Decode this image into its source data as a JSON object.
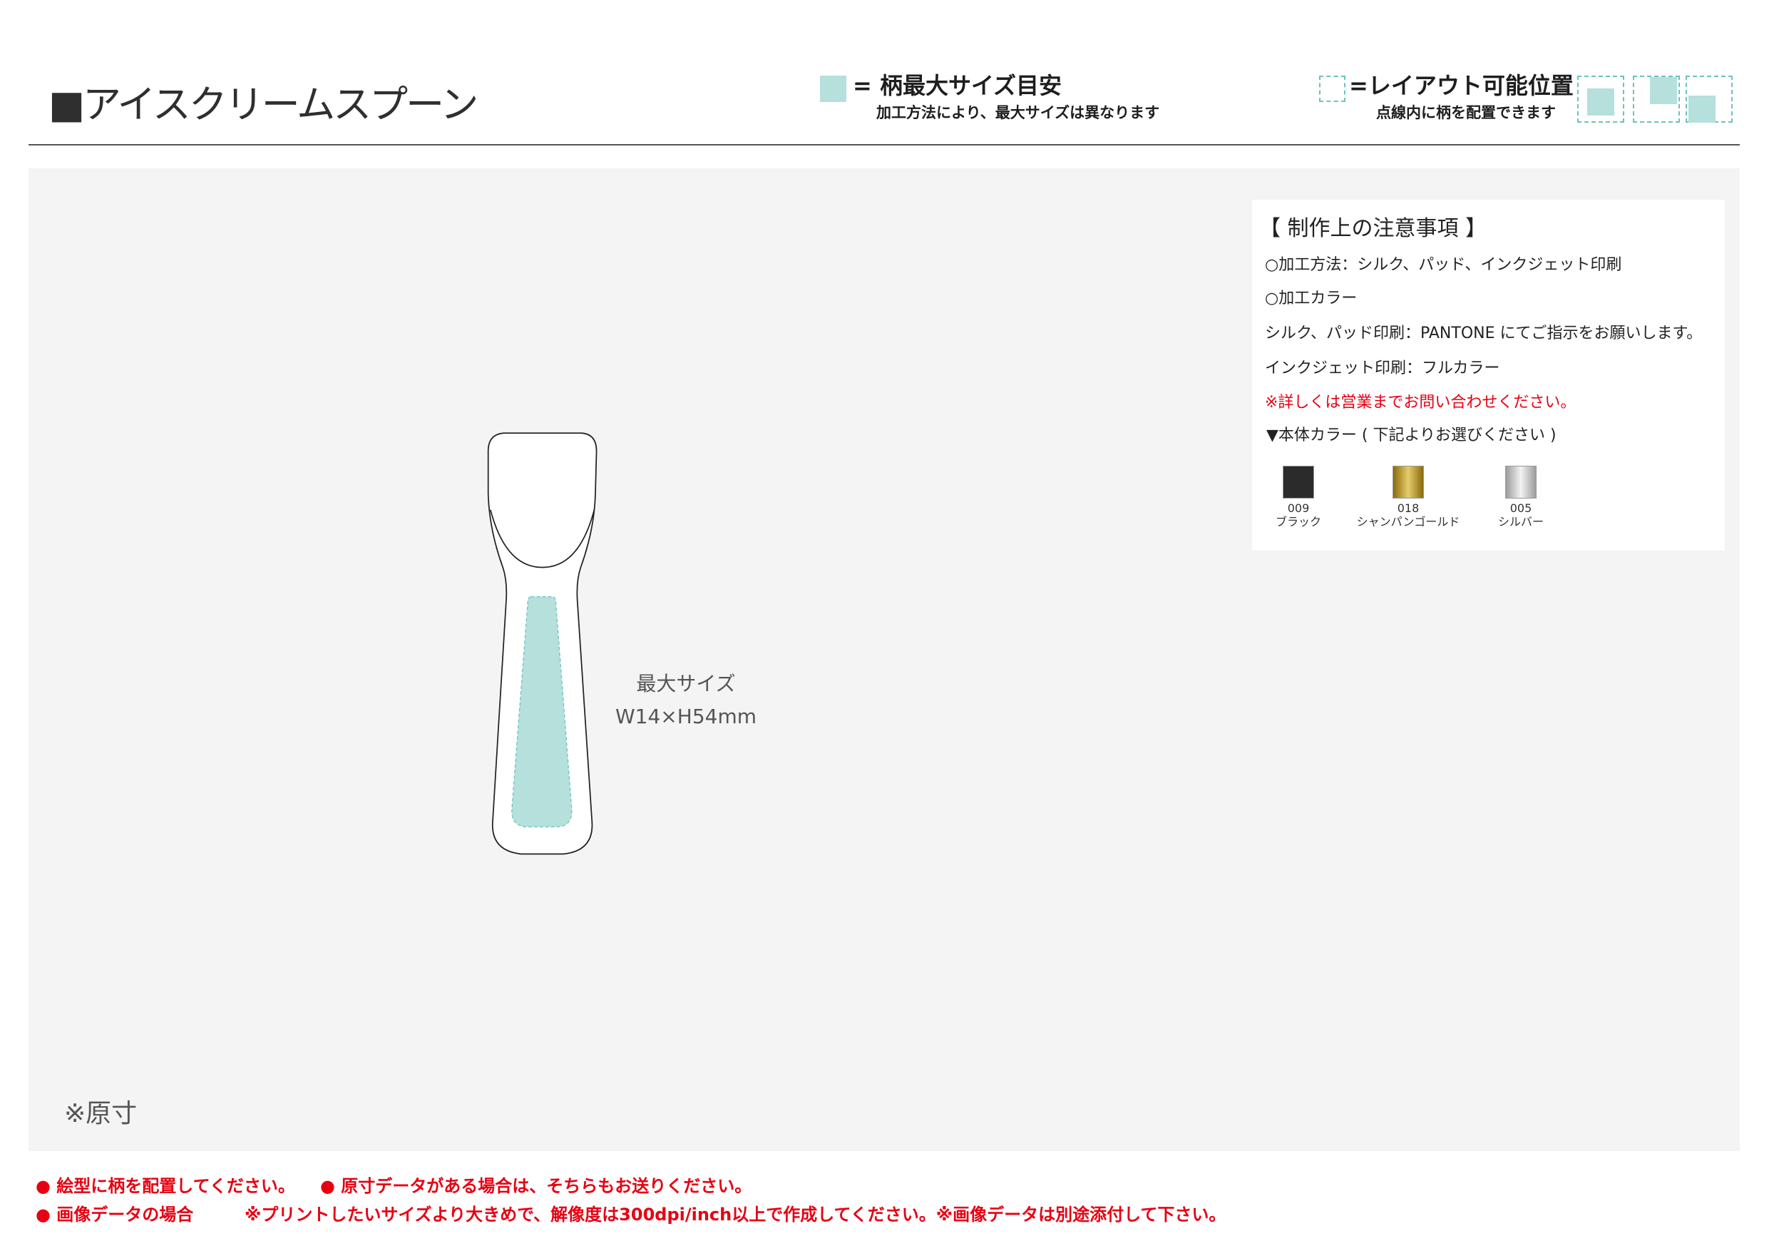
{
  "header": {
    "title": "■アイスクリームスプーン"
  },
  "legend": {
    "max_size": {
      "label": "= 柄最大サイズ目安",
      "note": "加工方法により、最大サイズは異なります"
    },
    "layout_area": {
      "label": "=レイアウト可能位置",
      "note": "点線内に柄を配置できます"
    }
  },
  "notes": {
    "heading": "【 制作上の注意事項 】",
    "lines": [
      "○加工方法：シルク、パッド、インクジェット印刷",
      "○加工カラー",
      "シルク、パッド印刷：PANTONE にてご指示をお願いします。",
      "インクジェット印刷：フルカラー"
    ],
    "contact": "※詳しくは営業までお問い合わせください。",
    "body_color_heading": "▼本体カラー ( 下記よりお選びください )",
    "body_colors": [
      {
        "code": "009",
        "name": "ブラック",
        "swatch": [
          "#2b2b2b",
          "#2b2b2b",
          "#2b2b2b"
        ]
      },
      {
        "code": "018",
        "name": "シャンパンゴールド",
        "swatch": [
          "#8a6a0c",
          "#e6cc6a",
          "#8a6a0c"
        ]
      },
      {
        "code": "005",
        "name": "シルバー",
        "swatch": [
          "#9c9c9c",
          "#f2f2f2",
          "#9c9c9c"
        ]
      }
    ]
  },
  "product": {
    "max_size_label": "最大サイズ",
    "max_size_value": "W14×H54mm"
  },
  "scale_note": "※原寸",
  "footer": {
    "line1": [
      "● 絵型に柄を配置してください。",
      "● 原寸データがある場合は、そちらもお送りください。"
    ],
    "line2": [
      "● 画像データの場合",
      "※プリントしたいサイズより大きめで、解像度は300dpi/inch以上で作成してください。※画像データは別途添付して下さい。"
    ]
  },
  "colors": {
    "accent_teal": "#b5e0dc",
    "dashed_teal": "#6cc3bd",
    "warning_red": "#e60012",
    "panel_gray": "#f4f4f4"
  }
}
